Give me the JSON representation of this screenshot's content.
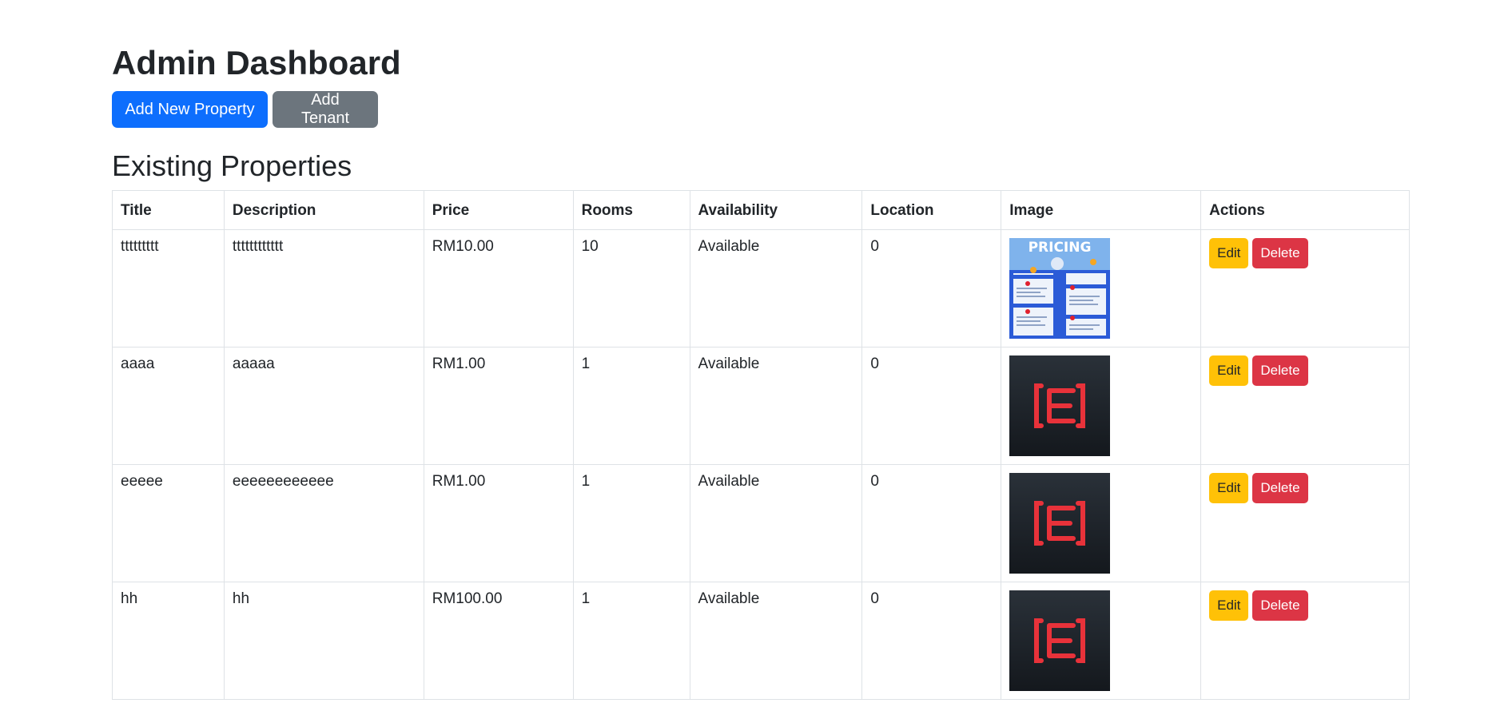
{
  "header": {
    "title": "Admin Dashboard",
    "add_property_label": "Add New Property",
    "add_tenant_label": "Add Tenant"
  },
  "section": {
    "title": "Existing Properties"
  },
  "table": {
    "headers": [
      "Title",
      "Description",
      "Price",
      "Rooms",
      "Availability",
      "Location",
      "Image",
      "Actions"
    ],
    "rows": [
      {
        "title": "ttttttttt",
        "description": "tttttttttttt",
        "price": "RM10.00",
        "rooms": "10",
        "availability": "Available",
        "location": "0",
        "image": "pricing-poster",
        "image_text": "PRICING"
      },
      {
        "title": "aaaa",
        "description": "aaaaa",
        "price": "RM1.00",
        "rooms": "1",
        "availability": "Available",
        "location": "0",
        "image": "red-e-logo"
      },
      {
        "title": "eeeee",
        "description": "eeeeeeeeeeee",
        "price": "RM1.00",
        "rooms": "1",
        "availability": "Available",
        "location": "0",
        "image": "red-e-logo"
      },
      {
        "title": "hh",
        "description": "hh",
        "price": "RM100.00",
        "rooms": "1",
        "availability": "Available",
        "location": "0",
        "image": "red-e-logo"
      }
    ],
    "edit_label": "Edit",
    "delete_label": "Delete"
  },
  "colors": {
    "primary": "#0d6efd",
    "secondary": "#6c757d",
    "warning": "#ffc107",
    "danger": "#dc3545"
  }
}
